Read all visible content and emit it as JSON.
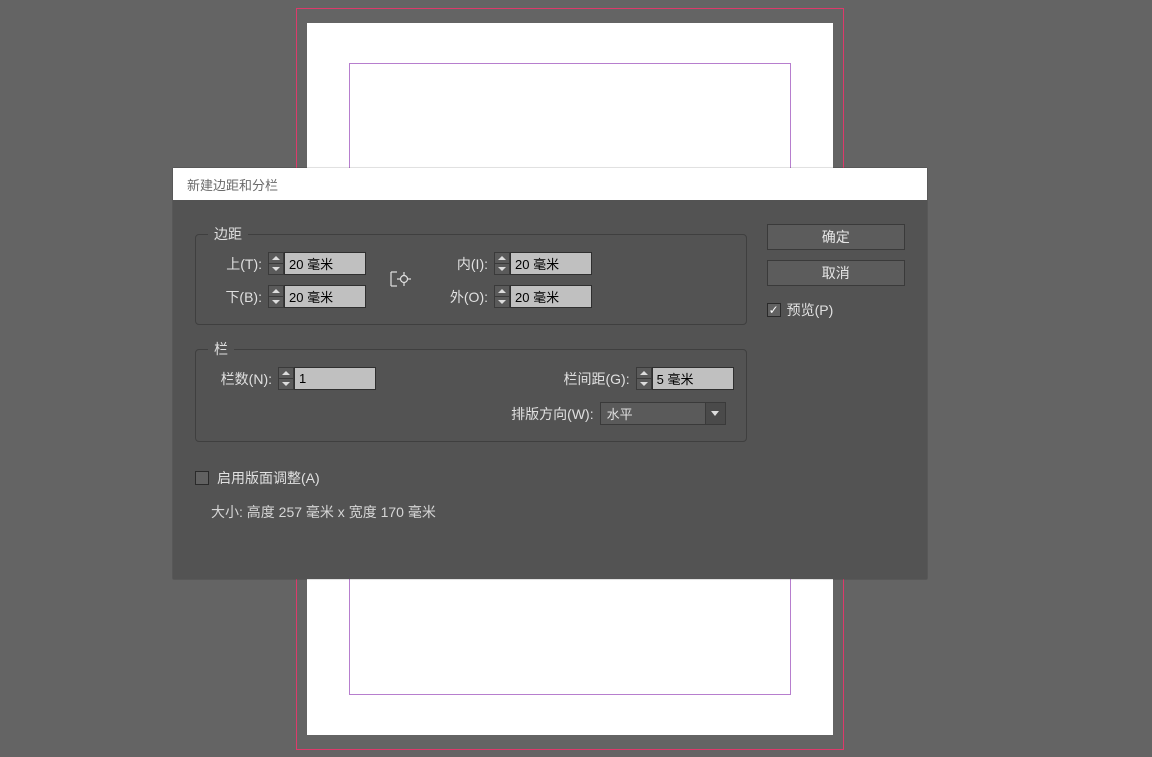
{
  "dialog": {
    "title": "新建边距和分栏",
    "margins": {
      "legend": "边距",
      "top": {
        "label": "上(T):",
        "value": "20 毫米"
      },
      "bottom": {
        "label": "下(B):",
        "value": "20 毫米"
      },
      "inside": {
        "label": "内(I):",
        "value": "20 毫米"
      },
      "outside": {
        "label": "外(O):",
        "value": "20 毫米"
      }
    },
    "columns": {
      "legend": "栏",
      "count": {
        "label": "栏数(N):",
        "value": "1"
      },
      "gutter": {
        "label": "栏间距(G):",
        "value": "5 毫米"
      },
      "direction": {
        "label": "排版方向(W):",
        "value": "水平"
      }
    },
    "layoutAdjust": {
      "label": "启用版面调整(A)",
      "checked": false
    },
    "sizeLine": "大小: 高度 257 毫米 x 宽度 170 毫米",
    "buttons": {
      "ok": "确定",
      "cancel": "取消"
    },
    "preview": {
      "label": "预览(P)",
      "checked": true
    }
  }
}
